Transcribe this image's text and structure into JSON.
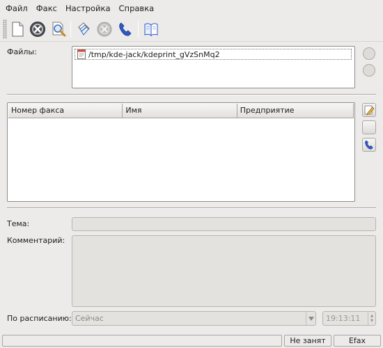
{
  "menu": {
    "file": "Файл",
    "fax": "Факс",
    "settings": "Настройка",
    "help": "Справка"
  },
  "toolbar": {
    "icons": [
      "new-document-icon",
      "stop-icon",
      "preview-zoom-icon",
      "attach-file-icon",
      "cancel-icon",
      "phone-icon",
      "address-book-icon"
    ]
  },
  "files": {
    "label": "Файлы:",
    "items": [
      "/tmp/kde-jack/kdeprint_gVzSnMq2"
    ]
  },
  "recipients": {
    "columns": [
      "Номер факса",
      "Имя",
      "Предприятие"
    ],
    "rows": []
  },
  "subject": {
    "label": "Тема:",
    "value": ""
  },
  "comment": {
    "label": "Комментарий:",
    "value": ""
  },
  "schedule": {
    "label": "По расписанию:",
    "selected": "Сейчас",
    "time": "19:13:11"
  },
  "status": {
    "message": "",
    "state": "Не занят",
    "system": "Efax"
  },
  "colors": {
    "background": "#ecebe9",
    "phone_blue": "#2f58c8",
    "stop_dark": "#4a4d55"
  }
}
